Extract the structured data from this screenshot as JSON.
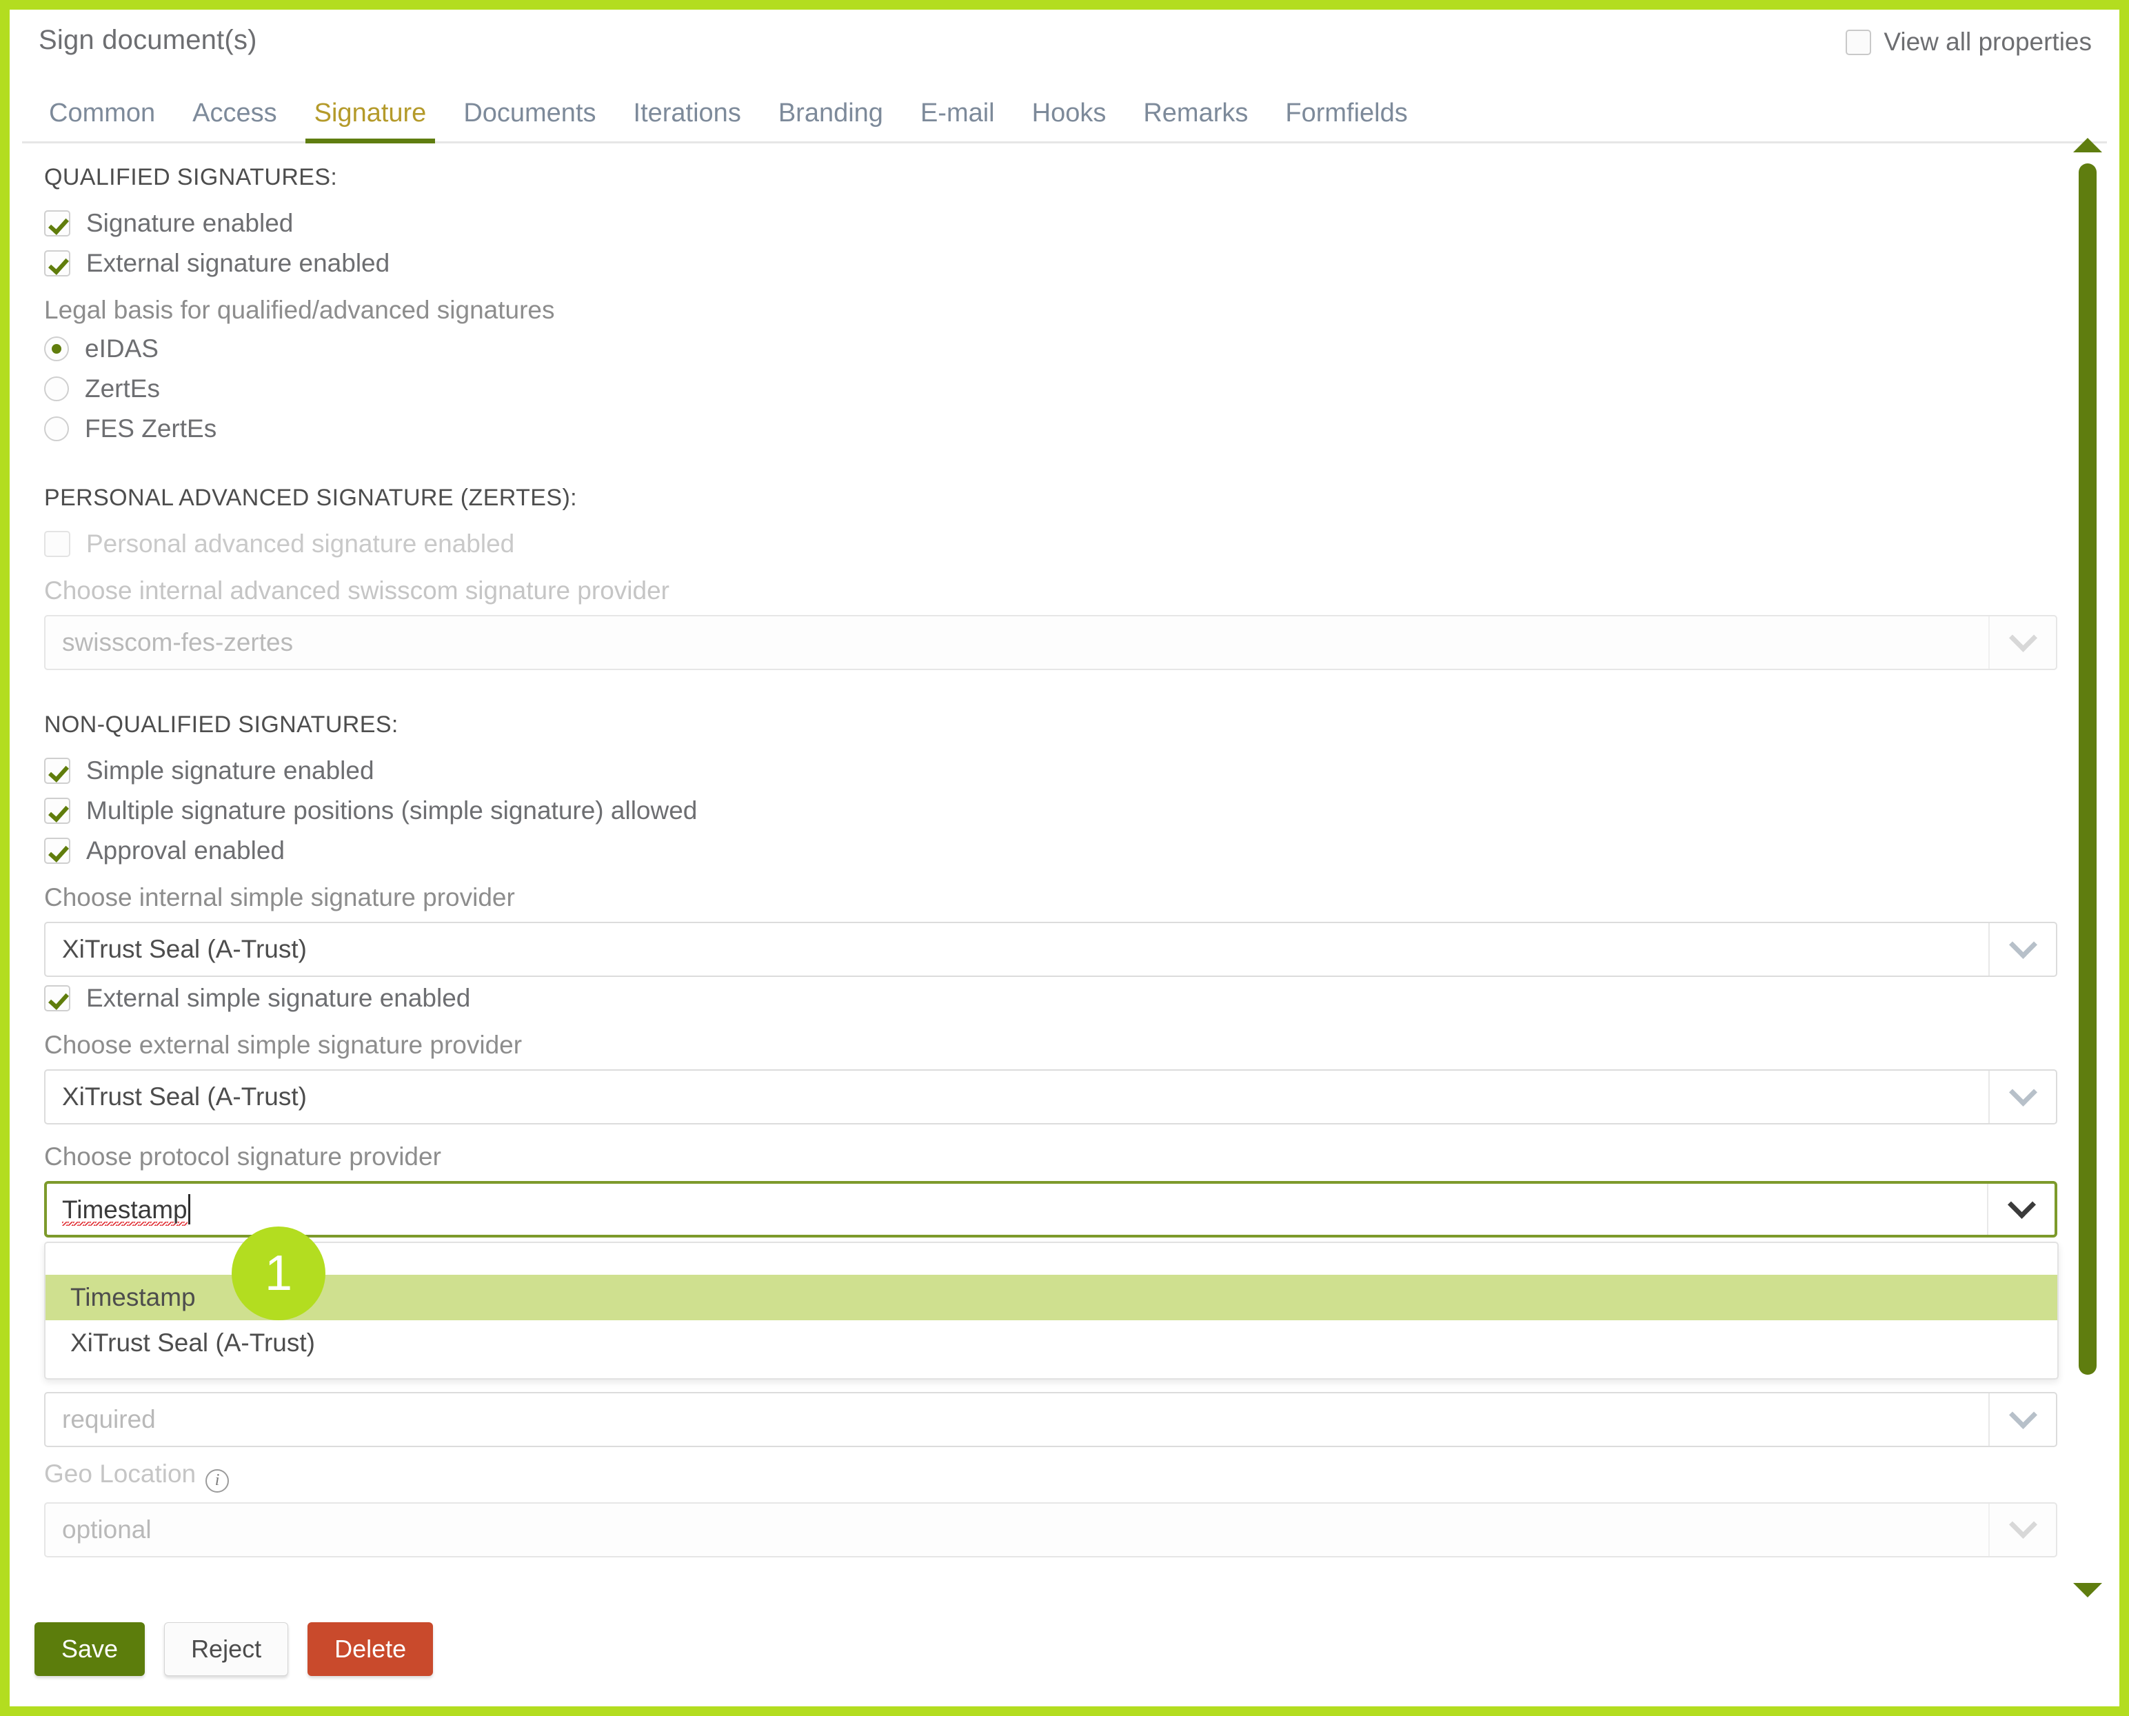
{
  "window": {
    "title": "Sign document(s)",
    "view_all_properties_label": "View all properties",
    "view_all_properties_checked": false
  },
  "tabs": [
    {
      "label": "Common",
      "active": false
    },
    {
      "label": "Access",
      "active": false
    },
    {
      "label": "Signature",
      "active": true
    },
    {
      "label": "Documents",
      "active": false
    },
    {
      "label": "Iterations",
      "active": false
    },
    {
      "label": "Branding",
      "active": false
    },
    {
      "label": "E-mail",
      "active": false
    },
    {
      "label": "Hooks",
      "active": false
    },
    {
      "label": "Remarks",
      "active": false
    },
    {
      "label": "Formfields",
      "active": false
    }
  ],
  "qualified": {
    "heading": "QUALIFIED SIGNATURES:",
    "signature_enabled_label": "Signature enabled",
    "external_signature_enabled_label": "External signature enabled",
    "legal_basis_label": "Legal basis for qualified/advanced signatures",
    "radio_eidas": "eIDAS",
    "radio_zertes": "ZertEs",
    "radio_fes_zertes": "FES ZertEs",
    "selected_radio": "eIDAS"
  },
  "personal_advanced": {
    "heading": "PERSONAL ADVANCED SIGNATURE (ZERTES):",
    "enabled_label": "Personal advanced signature enabled",
    "provider_label": "Choose internal advanced swisscom signature provider",
    "provider_value": "swisscom-fes-zertes"
  },
  "non_qualified": {
    "heading": "NON-QUALIFIED SIGNATURES:",
    "simple_signature_enabled_label": "Simple signature enabled",
    "multiple_positions_label": "Multiple signature positions (simple signature) allowed",
    "approval_enabled_label": "Approval enabled",
    "internal_provider_label": "Choose internal simple signature provider",
    "internal_provider_value": "XiTrust Seal (A-Trust)",
    "external_simple_enabled_label": "External simple signature enabled",
    "external_provider_label": "Choose external simple signature provider",
    "external_provider_value": "XiTrust Seal (A-Trust)",
    "protocol_provider_label": "Choose protocol signature provider",
    "protocol_provider_value": "Timestamp",
    "protocol_options": [
      {
        "label": "Timestamp",
        "highlighted": true
      },
      {
        "label": "XiTrust Seal (A-Trust)",
        "highlighted": false
      }
    ],
    "required_placeholder": "required",
    "geo_location_label": "Geo Location",
    "optional_placeholder": "optional"
  },
  "badge": {
    "number": "1"
  },
  "footer": {
    "save_label": "Save",
    "reject_label": "Reject",
    "delete_label": "Delete"
  },
  "colors": {
    "frame_green": "#b3dd20",
    "accent_dark_green": "#5f7d0f",
    "highlight_green": "#cfe08f",
    "delete_red": "#c94a2c"
  }
}
